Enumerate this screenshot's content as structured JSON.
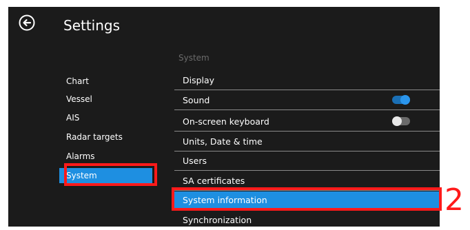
{
  "header": {
    "title": "Settings",
    "back_icon": "back-arrow-icon"
  },
  "sidebar": {
    "items": [
      {
        "label": "Chart"
      },
      {
        "label": "Vessel"
      },
      {
        "label": "AIS"
      },
      {
        "label": "Radar targets"
      },
      {
        "label": "Alarms"
      },
      {
        "label": "System",
        "selected": true
      }
    ]
  },
  "content": {
    "section_title": "System",
    "rows": [
      {
        "label": "Display"
      },
      {
        "label": "Sound",
        "toggle": "on"
      },
      {
        "label": "On-screen keyboard",
        "toggle": "off"
      },
      {
        "label": "Units, Date & time"
      },
      {
        "label": "Users"
      },
      {
        "label": "SA certificates"
      },
      {
        "label": "System information",
        "selected": true
      },
      {
        "label": "Synchronization"
      }
    ]
  },
  "annotation": {
    "step_number": "2",
    "highlight_color": "#ff1a1a"
  },
  "colors": {
    "accent": "#1e8fe1",
    "background": "#1b1b1b",
    "text": "#ffffff"
  }
}
